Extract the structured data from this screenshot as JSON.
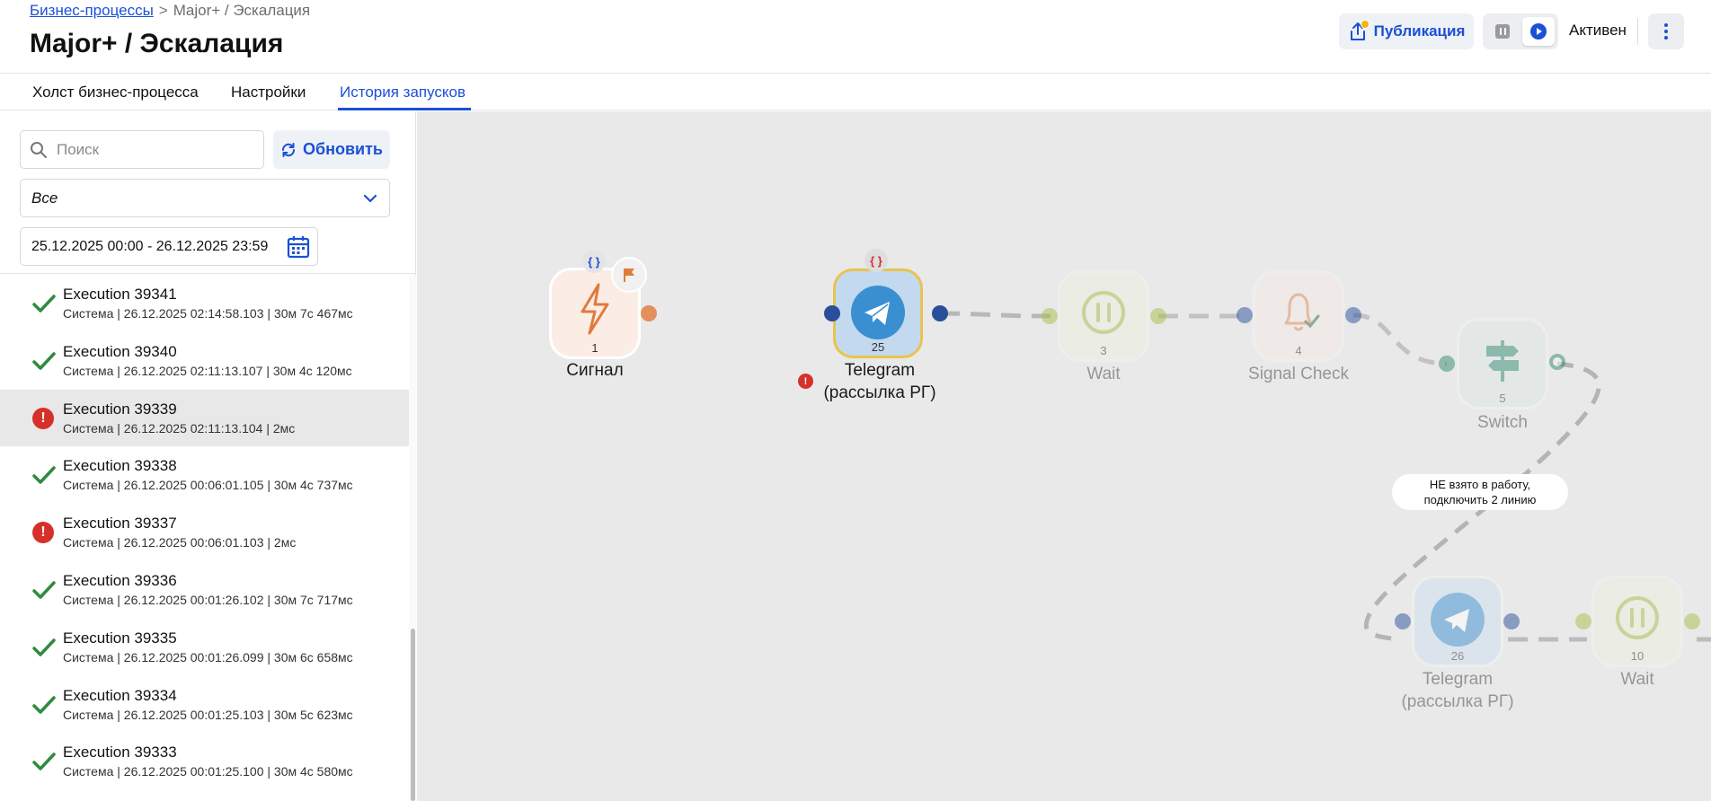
{
  "header": {
    "breadcrumb_link": "Бизнес-процессы",
    "breadcrumb_separator": ">",
    "breadcrumb_current": "Major+ / Эскалация",
    "title": "Major+ / Эскалация",
    "publish_label": "Публикация",
    "status_label": "Активен"
  },
  "tabs": [
    {
      "label": "Холст бизнес-процесса"
    },
    {
      "label": "Настройки"
    },
    {
      "label": "История запусков"
    }
  ],
  "sidebar": {
    "search_placeholder": "Поиск",
    "refresh_label": "Обновить",
    "filter_value": "Все",
    "date_range": "25.12.2025 00:00 - 26.12.2025 23:59",
    "executions": [
      {
        "name": "Execution 39341",
        "meta": "Система | 26.12.2025 02:14:58.103 | 30м 7с 467мс",
        "status": "success"
      },
      {
        "name": "Execution 39340",
        "meta": "Система | 26.12.2025 02:11:13.107 | 30м 4с 120мс",
        "status": "success"
      },
      {
        "name": "Execution 39339",
        "meta": "Система | 26.12.2025 02:11:13.104 | 2мс",
        "status": "error"
      },
      {
        "name": "Execution 39338",
        "meta": "Система | 26.12.2025 00:06:01.105 | 30м 4с 737мс",
        "status": "success"
      },
      {
        "name": "Execution 39337",
        "meta": "Система | 26.12.2025 00:06:01.103 | 2мс",
        "status": "error"
      },
      {
        "name": "Execution 39336",
        "meta": "Система | 26.12.2025 00:01:26.102 | 30м 7с 717мс",
        "status": "success"
      },
      {
        "name": "Execution 39335",
        "meta": "Система | 26.12.2025 00:01:26.099 | 30м 6с 658мс",
        "status": "success"
      },
      {
        "name": "Execution 39334",
        "meta": "Система | 26.12.2025 00:01:25.103 | 30м 5с 623мс",
        "status": "success"
      },
      {
        "name": "Execution 39333",
        "meta": "Система | 26.12.2025 00:01:25.100 | 30м 4с 580мс",
        "status": "success"
      }
    ]
  },
  "canvas": {
    "nodes": [
      {
        "id": "1",
        "label": "Сигнал"
      },
      {
        "id": "25",
        "label_line1": "Telegram",
        "label_line2": "(рассылка РГ)"
      },
      {
        "id": "3",
        "label": "Wait"
      },
      {
        "id": "4",
        "label": "Signal Check"
      },
      {
        "id": "5",
        "label": "Switch"
      },
      {
        "id": "26",
        "label_line1": "Telegram",
        "label_line2": "(рассылка РГ)"
      },
      {
        "id": "10",
        "label": "Wait"
      }
    ],
    "edge_label_line1": "НЕ взято в работу,",
    "edge_label_line2": "подключить 2 линию",
    "badge_error": "!"
  },
  "colors": {
    "accent": "#1b4fd6",
    "success": "#2e8b3e",
    "error": "#d6302b",
    "publish_dot": "#f2b500"
  }
}
